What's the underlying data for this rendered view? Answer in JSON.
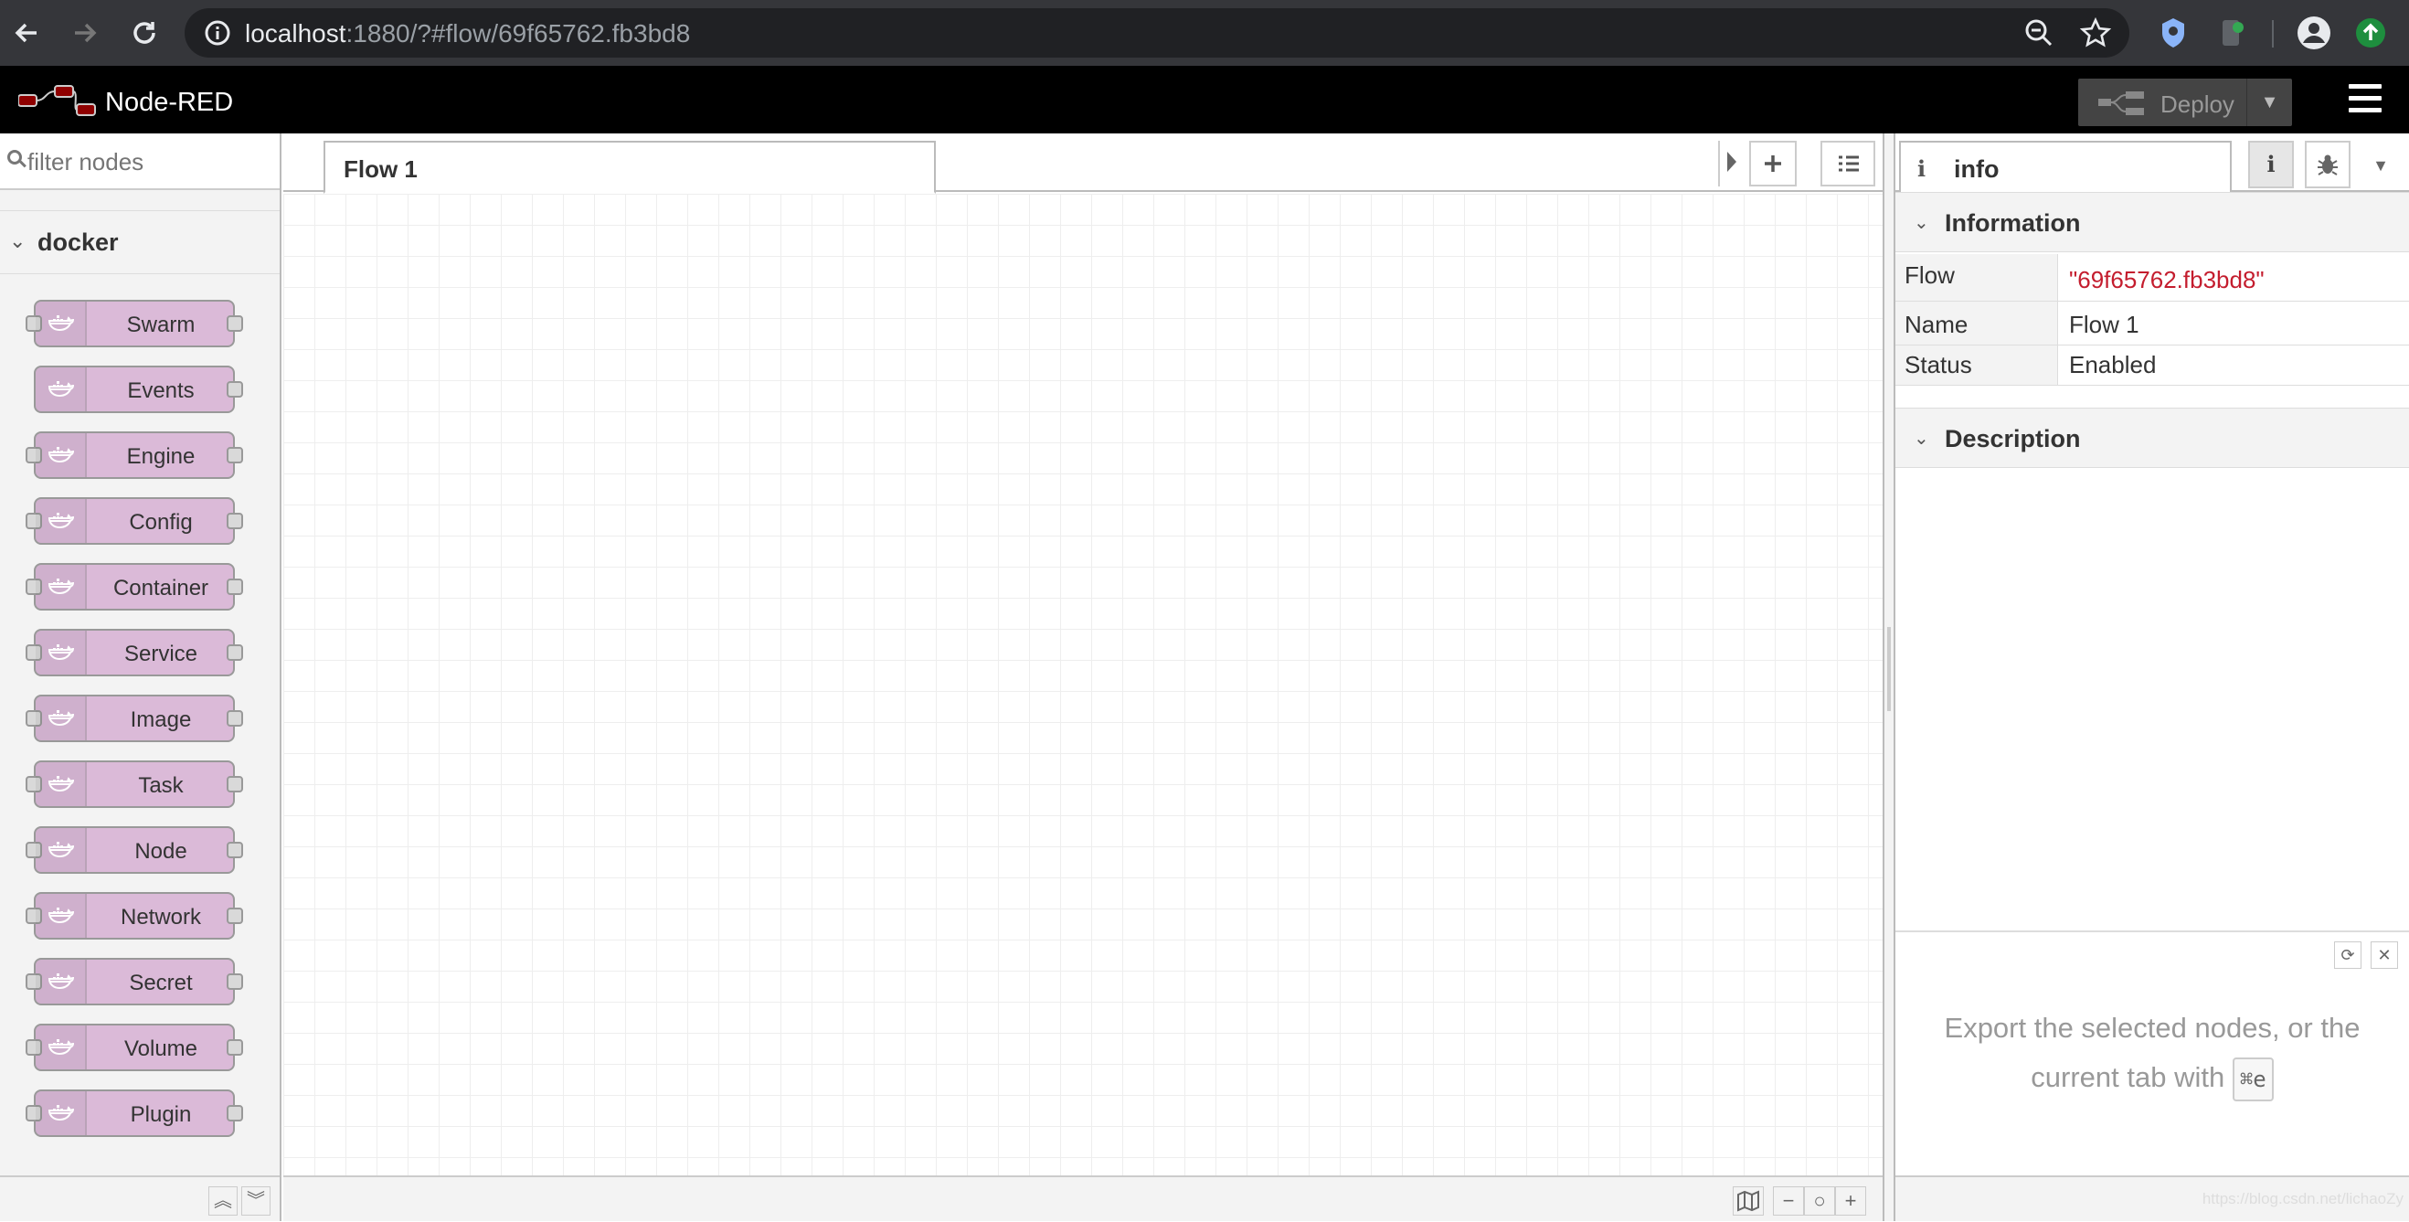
{
  "browser": {
    "url_host": "localhost",
    "url_rest": ":1880/?#flow/69f65762.fb3bd8"
  },
  "header": {
    "app_title": "Node-RED",
    "deploy_label": "Deploy"
  },
  "palette": {
    "filter_placeholder": "filter nodes",
    "category": "docker",
    "nodes": [
      {
        "label": "Swarm",
        "has_input": true,
        "has_output": true
      },
      {
        "label": "Events",
        "has_input": false,
        "has_output": true
      },
      {
        "label": "Engine",
        "has_input": true,
        "has_output": true
      },
      {
        "label": "Config",
        "has_input": true,
        "has_output": true
      },
      {
        "label": "Container",
        "has_input": true,
        "has_output": true
      },
      {
        "label": "Service",
        "has_input": true,
        "has_output": true
      },
      {
        "label": "Image",
        "has_input": true,
        "has_output": true
      },
      {
        "label": "Task",
        "has_input": true,
        "has_output": true
      },
      {
        "label": "Node",
        "has_input": true,
        "has_output": true
      },
      {
        "label": "Network",
        "has_input": true,
        "has_output": true
      },
      {
        "label": "Secret",
        "has_input": true,
        "has_output": true
      },
      {
        "label": "Volume",
        "has_input": true,
        "has_output": true
      },
      {
        "label": "Plugin",
        "has_input": true,
        "has_output": true
      }
    ],
    "node_color": "#dbbad8"
  },
  "workspace": {
    "tabs": [
      {
        "label": "Flow 1"
      }
    ]
  },
  "sidebar": {
    "active_tab": "info",
    "information_title": "Information",
    "rows": [
      {
        "key": "Flow",
        "value": "\"69f65762.fb3bd8\"",
        "is_string": true
      },
      {
        "key": "Name",
        "value": "Flow 1",
        "is_string": false
      },
      {
        "key": "Status",
        "value": "Enabled",
        "is_string": false
      }
    ],
    "description_title": "Description",
    "tip_text": "Export the selected nodes, or the current tab with",
    "tip_shortcut": "⌘e",
    "watermark": "https://blog.csdn.net/lichaoZy"
  },
  "colors": {
    "header_bg": "#000000",
    "flow_id_string": "#c41d2e",
    "logo_red": "#8f0000"
  },
  "icons": [
    "back-icon",
    "forward-icon",
    "reload-icon",
    "info-circle-icon",
    "zoom-icon",
    "star-icon",
    "extension-icon",
    "profile-icon",
    "update-icon",
    "deploy-icon",
    "hamburger-icon",
    "docker-whale-icon",
    "debug-bug-icon",
    "refresh-icon",
    "close-icon",
    "map-icon"
  ]
}
